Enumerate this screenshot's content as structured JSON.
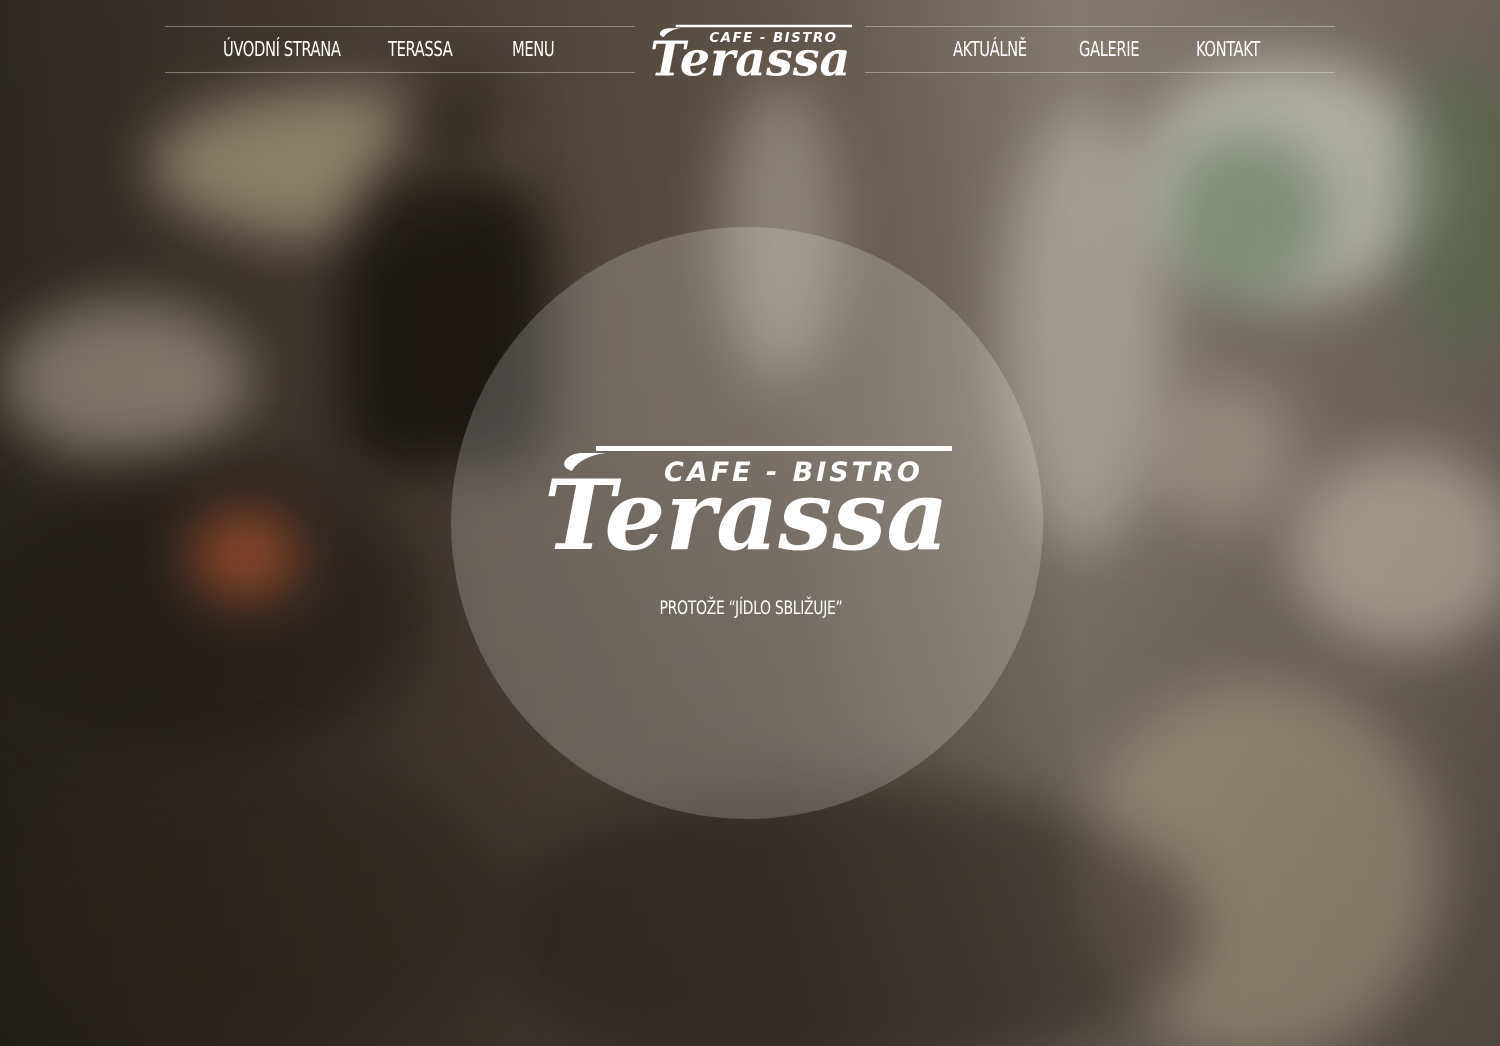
{
  "nav": {
    "left": [
      {
        "label": "ÚVODNÍ STRANA"
      },
      {
        "label": "TERASSA"
      },
      {
        "label": "MENU"
      }
    ],
    "right": [
      {
        "label": "AKTUÁLNĚ"
      },
      {
        "label": "GALERIE"
      },
      {
        "label": "KONTAKT"
      }
    ]
  },
  "logo": {
    "subtitle": "CAFE - BISTRO",
    "name": "Terassa"
  },
  "hero": {
    "tagline": "PROTOŽE “JÍDLO SBLIŽUJE”"
  },
  "colors": {
    "text": "#ffffff",
    "circle_overlay": "rgba(255,255,255,0.20)"
  }
}
